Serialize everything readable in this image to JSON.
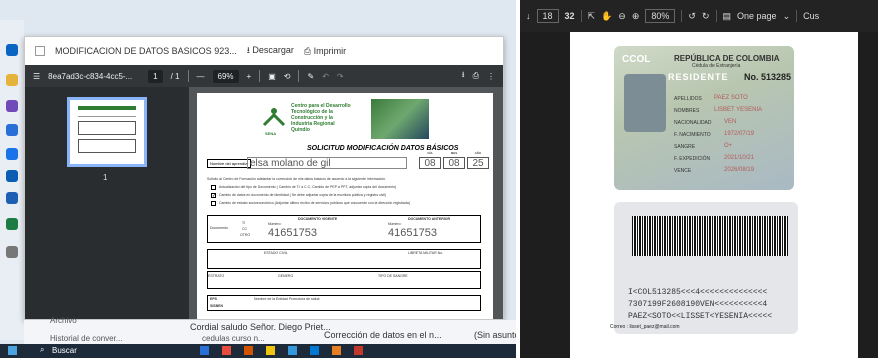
{
  "left": {
    "viewer": {
      "title": "MODIFICACION DE DATOS BASICOS 923...",
      "download": "Descargar",
      "print": "Imprimir",
      "file_name": "8ea7ad3c-c834-4cc5-...",
      "page_current": "1",
      "page_total": "/ 1",
      "zoom": "69%",
      "thumb_page": "1"
    },
    "document": {
      "header_org": "Centro para el Desarrollo Tecnológico de la Construcción y la Industria Regional Quindío",
      "sena": "SENA",
      "title": "SOLICITUD MODIFICACIÓN DATOS BÁSICOS",
      "nombre_label": "Nombre del aprendiz:",
      "nombre_value": "elsa molano de gil",
      "date_headers": [
        "DÍA",
        "MES",
        "AÑO"
      ],
      "date_values": [
        "08",
        "08",
        "25"
      ],
      "request_line": "Solicito al Centro de Formación adelantar la corrección de mis datos básicos de acuerdo a la siguiente información.",
      "options": [
        "Actualización del tipo de Documento ( Cambio de T.I a C.C, Cambio de PEP a PPT, adjuntar copia del documento)",
        "Cambio de datos en documento de identidad ( Se debe adjuntar copia de la escritura pública y registro civil)",
        "Cambio de estrato socioeconómico (Adjuntar último recibo de servicios públicos que concuerde con la dirección registrada)"
      ],
      "doc_label": "Documento",
      "doc_vigente": "DOCUMENTO VIGENTE",
      "doc_anterior": "DOCUMENTO ANTERIOR",
      "numero_label": "Número:",
      "doc_types": [
        "TI",
        "CC",
        "OTRO"
      ],
      "doc_vigente_num": "41651753",
      "doc_anterior_num": "41651753",
      "estado_civil": "ESTADO CIVIL",
      "libreta_militar": "LIBRETA MILITAR No.",
      "estrato": "ESTRATO",
      "genero": "GENERO",
      "tipo_sangre": "TIPO DE SANGRE",
      "eps": "EPS",
      "sisben": "SISBEN",
      "eps_note": "Nombre de la Entidad Promotora de salud:"
    },
    "taskbar": {
      "search": "Buscar",
      "mail_snippet": "Cordial saludo Señor. Diego Priet...",
      "mail_subject": "Corrección de datos en el n...",
      "mail_status": "(Sin asunto",
      "archivo": "Archivo",
      "historial": "Historial de conver...",
      "cedula": "cedulas curso n..."
    }
  },
  "right": {
    "toolbar": {
      "page_current": "18",
      "page_total": "32",
      "zoom": "80%",
      "view_mode": "One page",
      "custom": "Cus"
    },
    "card_front": {
      "ccol": "CCOL",
      "country": "REPÚBLICA DE COLOMBIA",
      "doc_type": "Cédula de Extranjería",
      "residente": "RESIDENTE",
      "no_label": "No.",
      "number": "513285",
      "fields": [
        {
          "label": "APELLIDOS",
          "value": "PAEZ SOTO"
        },
        {
          "label": "NOMBRES",
          "value": "LISBET YESENIA"
        },
        {
          "label": "NACIONALIDAD",
          "value": "VEN"
        },
        {
          "label": "F. NACIMIENTO",
          "value": "1972/07/19"
        },
        {
          "label": "SANGRE",
          "value": "O+"
        },
        {
          "label": "F. EXPEDICIÓN",
          "value": "2021/10/21"
        },
        {
          "label": "VENCE",
          "value": "2026/08/19"
        }
      ]
    },
    "card_back": {
      "mrz": [
        "I<COL513285<<<4<<<<<<<<<<<<<<",
        "7307199F2608190VEN<<<<<<<<<<4",
        "PAEZ<SOTO<<LISSET<YESENIA<<<<<"
      ]
    },
    "correo": "Correo : lisset_paez@mail.com"
  },
  "colors": {
    "pdf_toolbar": "#323639",
    "viewer_bg": "#525659",
    "sena_green": "#2e7d32",
    "dark_bg": "#1e1e1e"
  }
}
